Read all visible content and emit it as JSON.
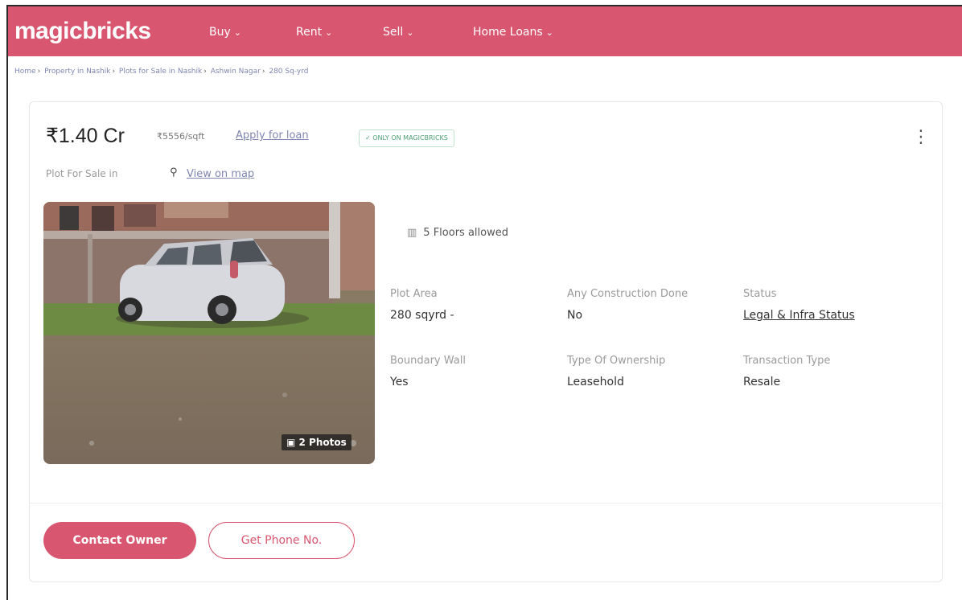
{
  "header": {
    "logo": "magicbricks",
    "nav": [
      {
        "label": "Buy"
      },
      {
        "label": "Rent"
      },
      {
        "label": "Sell"
      },
      {
        "label": "Home Loans"
      }
    ]
  },
  "breadcrumb": [
    "Home",
    "Property in Nashik",
    "Plots for Sale in Nashik",
    "Ashwin Nagar",
    "280 Sq-yrd"
  ],
  "listing": {
    "price": "₹1.40 Cr",
    "price_per_sqft": "₹5556/sqft",
    "apply_loan": "Apply for loan",
    "exclusive_badge": "✓ ONLY ON MAGICBRICKS",
    "subtitle": "Plot For Sale in",
    "view_map": "View on map",
    "photo_count": "2 Photos",
    "floors_allowed": "5 Floors allowed",
    "attributes": [
      {
        "label": "Plot Area",
        "value": "280 sqyrd -"
      },
      {
        "label": "Any Construction Done",
        "value": "No"
      },
      {
        "label": "Status",
        "value": "Legal & Infra Status"
      },
      {
        "label": "Boundary Wall",
        "value": "Yes"
      },
      {
        "label": "Type Of Ownership",
        "value": "Leasehold"
      },
      {
        "label": "Transaction Type",
        "value": "Resale"
      }
    ]
  },
  "actions": {
    "contact_owner": "Contact Owner",
    "get_phone": "Get Phone No."
  },
  "colors": {
    "brand": "#d8566f",
    "link": "#7f86b2",
    "badge_green": "#4b9f74"
  }
}
